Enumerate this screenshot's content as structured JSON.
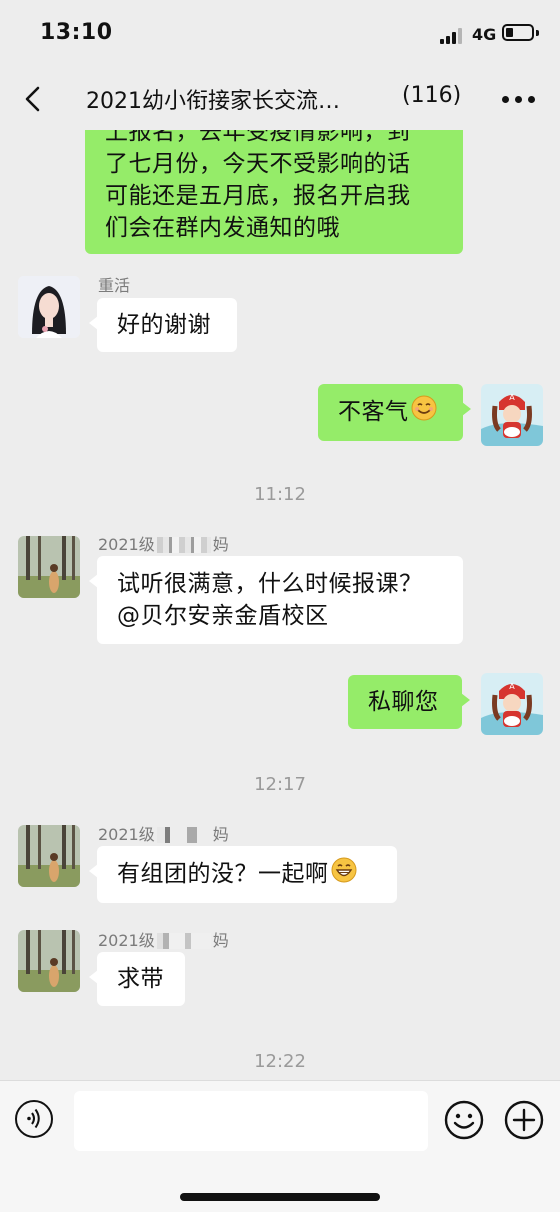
{
  "status_bar": {
    "time": "13:10",
    "network": "4G"
  },
  "header": {
    "title": "2021幼小衔接家长交流…",
    "member_count": "(116)"
  },
  "messages": [
    {
      "type": "out",
      "lines": [
        "上报名，去年受疫情影响，到",
        "了七月份，今天不受影响的话",
        "可能还是五月底，报名开启我",
        "们会在群内发通知的哦"
      ]
    },
    {
      "type": "in",
      "sender": "重活",
      "text": "好的谢谢"
    },
    {
      "type": "out",
      "text": "不客气",
      "emoji": "smiling-face-emoji"
    },
    {
      "type": "time",
      "text": "11:12"
    },
    {
      "type": "in",
      "sender": "2021级",
      "sender_suffix": "妈",
      "lines": [
        "试听很满意，什么时候报课？",
        "@贝尔安亲金盾校区"
      ]
    },
    {
      "type": "out",
      "text": "私聊您"
    },
    {
      "type": "time",
      "text": "12:17"
    },
    {
      "type": "in",
      "sender": "2021级",
      "sender_suffix": "妈",
      "text": "有组团的没？一起啊",
      "emoji": "grinning-face-emoji"
    },
    {
      "type": "in",
      "sender": "2021级",
      "sender_suffix": "妈",
      "text": "求带"
    },
    {
      "type": "time",
      "text": "12:22"
    }
  ],
  "input_bar": {
    "value": "",
    "placeholder": ""
  },
  "icons": [
    "back-icon",
    "more-icon",
    "voice-icon",
    "emoji-icon",
    "plus-icon"
  ],
  "colors": {
    "background": "#ededed",
    "outgoing_bubble": "#95ec69",
    "incoming_bubble": "#ffffff",
    "input_bar": "#f6f6f6"
  }
}
